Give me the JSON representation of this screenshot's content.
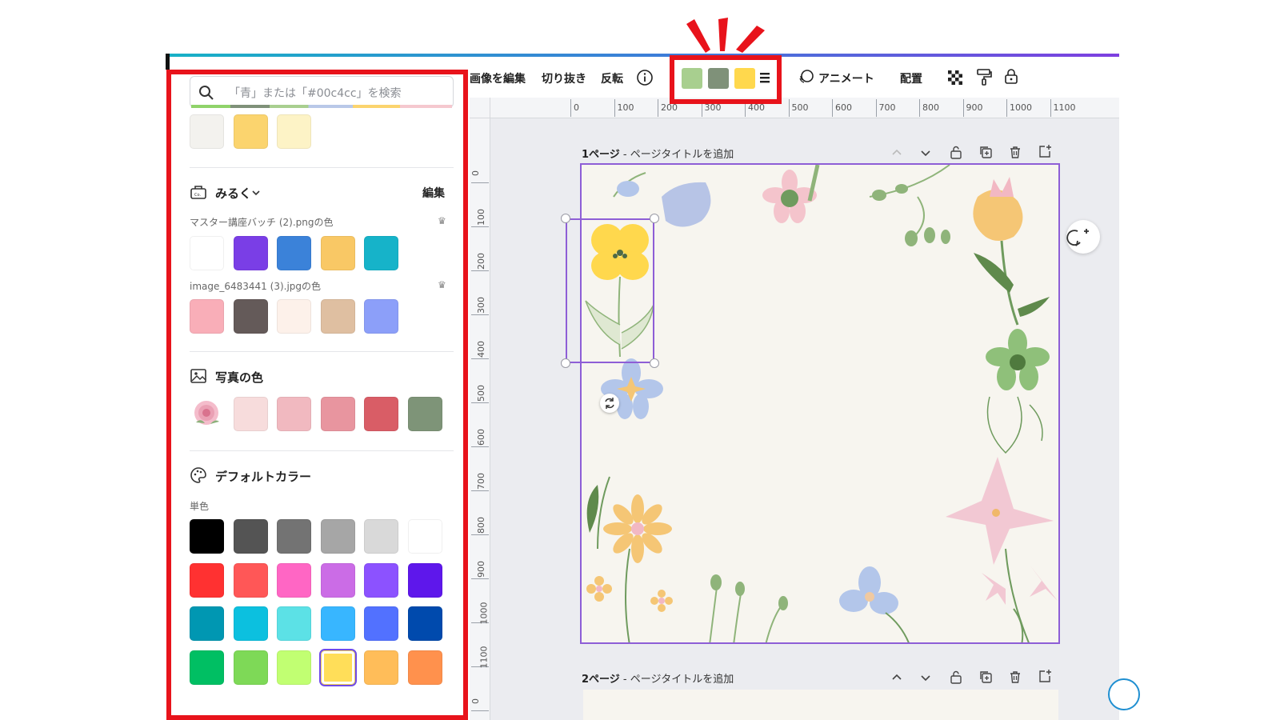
{
  "panel": {
    "search_placeholder": "「青」または「#00c4cc」を検索",
    "top_colors": [
      "#f3f2ee",
      "#fbd46e",
      "#fdf3c6"
    ],
    "brand_section": {
      "title": "みるく",
      "edit_label": "編集",
      "palettes": [
        {
          "label": "マスター講座バッチ (2).pngの色",
          "colors": [
            "#ffffff",
            "#7a3ee6",
            "#3b82d9",
            "#f9c865",
            "#16b3c9"
          ]
        },
        {
          "label": "image_6483441 (3).jpgの色",
          "colors": [
            "#f9aeb8",
            "#645a59",
            "#fdf1ea",
            "#dfbfa1",
            "#8c9ff9"
          ]
        }
      ]
    },
    "photo_section": {
      "title": "写真の色",
      "colors": [
        "#f7dcdc",
        "#f1b9c0",
        "#e8959f",
        "#d95d66",
        "#7e9478"
      ]
    },
    "default_section": {
      "title": "デフォルトカラー",
      "solid_label": "単色",
      "colors": [
        [
          "#000000",
          "#545454",
          "#737373",
          "#a6a6a6",
          "#d9d9d9",
          "#ffffff"
        ],
        [
          "#ff3131",
          "#ff5757",
          "#ff66c4",
          "#cb6ce6",
          "#8c52ff",
          "#5e17eb"
        ],
        [
          "#0097b2",
          "#0cc0df",
          "#5ce1e6",
          "#38b6ff",
          "#5271ff",
          "#004aad"
        ],
        [
          "#00bf63",
          "#7ed957",
          "#c1ff72",
          "#ffde59",
          "#ffbd59",
          "#ff914d"
        ]
      ],
      "selected_index": [
        3,
        3
      ]
    }
  },
  "toolbar": {
    "edit_image": "画像を編集",
    "crop": "切り抜き",
    "flip": "反転",
    "info_icon": "info-icon",
    "colors": [
      "#a8cf8f",
      "#7f9179",
      "#ffd84d"
    ],
    "animate": "アニメート",
    "position": "配置"
  },
  "ruler": {
    "top": [
      "0",
      "100",
      "200",
      "300",
      "400",
      "500",
      "600",
      "700",
      "800",
      "900",
      "1000",
      "1100"
    ],
    "left": [
      "0",
      "100",
      "200",
      "300",
      "400",
      "500",
      "600",
      "700",
      "800",
      "900",
      "1000",
      "1100",
      "0"
    ]
  },
  "pages": [
    {
      "number_label": "1ページ",
      "title_placeholder": "ページタイトルを追加"
    },
    {
      "number_label": "2ページ",
      "title_placeholder": "ページタイトルを追加"
    }
  ],
  "colors": {
    "highlight": "#e8131b",
    "selection": "#8e5ed6",
    "accent_gradient_start": "#17b1c6",
    "accent_gradient_end": "#7e3fe0"
  }
}
